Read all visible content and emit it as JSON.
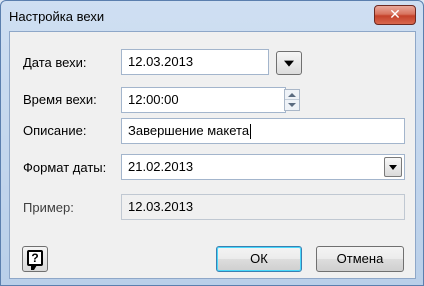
{
  "window": {
    "title": "Настройка вехи",
    "close_glyph": "✕"
  },
  "form": {
    "date": {
      "label": "Дата вехи:",
      "value": "12.03.2013"
    },
    "time": {
      "label": "Время вехи:",
      "value": "12:00:00"
    },
    "description": {
      "label": "Описание:",
      "value": "Завершение макета"
    },
    "date_format": {
      "label": "Формат даты:",
      "value": "21.02.2013"
    },
    "example": {
      "label": "Пример:",
      "value": "12.03.2013"
    }
  },
  "buttons": {
    "ok": "ОК",
    "cancel": "Отмена",
    "help_glyph": "?"
  },
  "icons": {
    "help": "help-icon",
    "calendar_dropdown": "chevron-down-icon",
    "format_dropdown": "chevron-down-icon",
    "spin_up": "arrow-up-icon",
    "spin_down": "arrow-down-icon",
    "close": "close-icon"
  },
  "colors": {
    "titlebar": "#cfdff2",
    "client_bg": "#f0f0f0",
    "close_button": "#c4412a",
    "primary_button_border": "#3c7fb1"
  }
}
